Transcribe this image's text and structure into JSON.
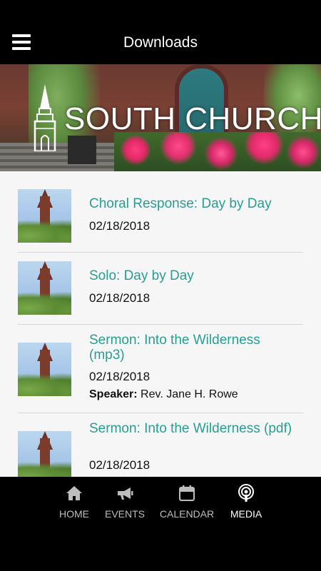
{
  "header": {
    "title": "Downloads"
  },
  "banner": {
    "title": "SOUTH CHURCH"
  },
  "items": [
    {
      "title": "Choral Response: Day by Day",
      "date": "02/18/2018"
    },
    {
      "title": "Solo: Day by Day",
      "date": "02/18/2018"
    },
    {
      "title": "Sermon: Into the Wilderness (mp3)",
      "date": "02/18/2018",
      "speaker_label": "Speaker:",
      "speaker": "Rev. Jane H. Rowe"
    },
    {
      "title": "Sermon: Into the Wilderness (pdf)",
      "date": "02/18/2018"
    }
  ],
  "nav": [
    {
      "label": "HOME",
      "icon": "home-icon"
    },
    {
      "label": "EVENTS",
      "icon": "megaphone-icon"
    },
    {
      "label": "CALENDAR",
      "icon": "calendar-icon"
    },
    {
      "label": "MEDIA",
      "icon": "podcast-icon",
      "active": true
    }
  ],
  "colors": {
    "accent": "#2a9d93",
    "bar": "#000000",
    "content_bg": "#f6f6f6"
  }
}
